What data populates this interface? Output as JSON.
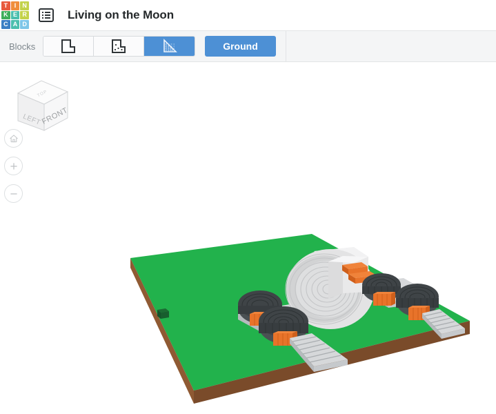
{
  "app": {
    "name": "Tinkercad",
    "logo_tiles": [
      {
        "letter": "T",
        "color": "#e8593c"
      },
      {
        "letter": "I",
        "color": "#f08d3c"
      },
      {
        "letter": "N",
        "color": "#c3d24a"
      },
      {
        "letter": "K",
        "color": "#3fae5a"
      },
      {
        "letter": "E",
        "color": "#4bbfae"
      },
      {
        "letter": "R",
        "color": "#c3d24a"
      },
      {
        "letter": "C",
        "color": "#3b7fc4"
      },
      {
        "letter": "A",
        "color": "#4bbfae"
      },
      {
        "letter": "D",
        "color": "#7ec6e8"
      }
    ]
  },
  "header": {
    "menu_icon": "list-menu-icon",
    "title": "Living on the Moon"
  },
  "toolbar": {
    "label": "Blocks",
    "shape_buttons": [
      {
        "name": "block-shape-solid",
        "icon": "notched-block-outline-icon",
        "selected": false
      },
      {
        "name": "block-shape-textured",
        "icon": "notched-block-dotted-icon",
        "selected": false
      },
      {
        "name": "block-shape-ramp",
        "icon": "ramp-grid-icon",
        "selected": true
      }
    ],
    "ground_label": "Ground",
    "accent_color": "#4d90d5"
  },
  "canvas": {
    "viewcube": {
      "top_face_label": "TOP",
      "left_face_label": "LEFT",
      "front_face_label": "FRONT"
    },
    "nav_buttons": [
      {
        "name": "home-view-button",
        "icon": "home-icon"
      },
      {
        "name": "zoom-in-button",
        "icon": "plus-icon"
      },
      {
        "name": "zoom-out-button",
        "icon": "minus-icon"
      }
    ],
    "scene": {
      "description": "Voxel model of a lunar habitat on a green ground plate",
      "ground_top_color": "#22b24c",
      "ground_side_color": "#8f5a33",
      "ground_front_color": "#7a4b2a",
      "dome_color": "#e3e3e4",
      "hab_dark_color": "#3f4447",
      "support_orange_color": "#e8732a",
      "stairs_color": "#d6d8da",
      "bush_color": "#14532a",
      "background_color": "#ffffff"
    }
  }
}
